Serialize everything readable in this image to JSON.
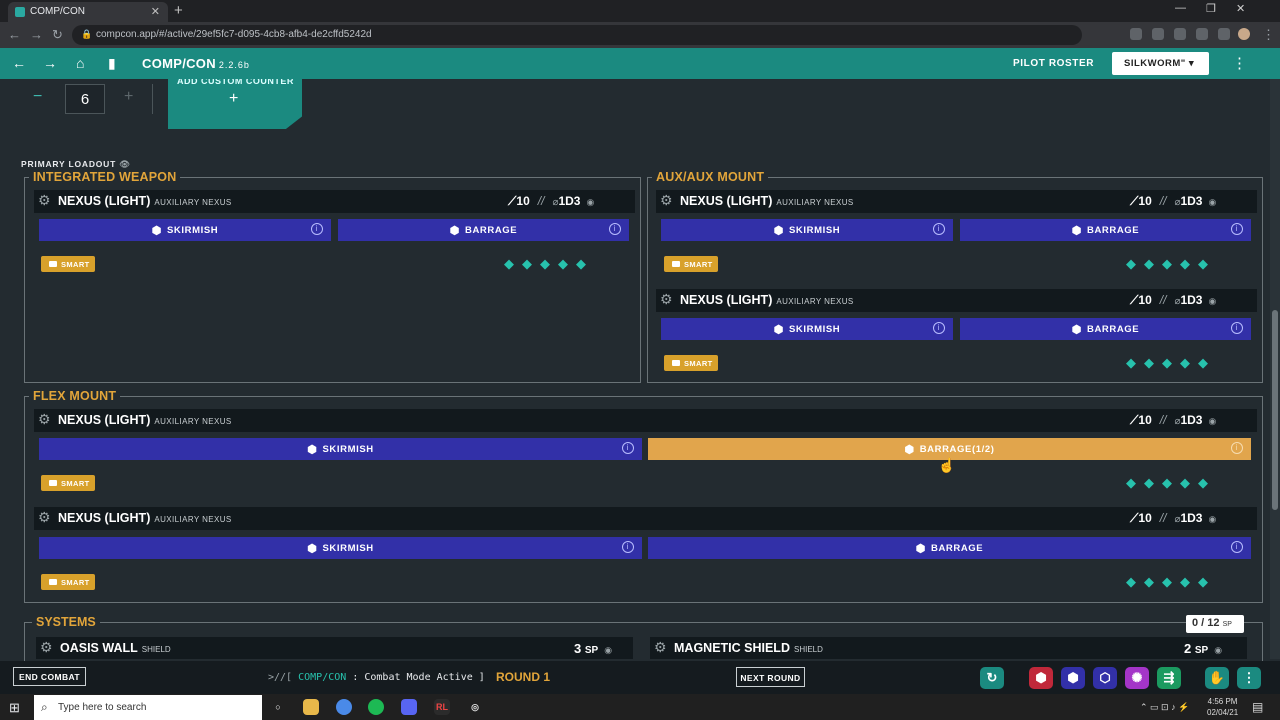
{
  "browser": {
    "tab_title": "COMP/CON",
    "url": "compcon.app/#/active/29ef5fc7-d095-4cb8-afb4-de2cffd5242d",
    "new_tab": "+",
    "close": "✕"
  },
  "header": {
    "title": "COMP/CON",
    "version": "2.2.6b",
    "pilot_roster": "PILOT ROSTER",
    "mech": "SILKWORM\"",
    "menu": "⋮"
  },
  "counter": {
    "minus": "−",
    "value": "6",
    "plus": "+",
    "add_custom": "ADD CUSTOM COUNTER",
    "add_plus": "+"
  },
  "loadout": {
    "label": "PRIMARY LOADOUT",
    "mounts": [
      {
        "title": "INTEGRATED WEAPON",
        "weapons": [
          {
            "name": "NEXUS (LIGHT)",
            "sub": "AUXILIARY NEXUS",
            "range": "10",
            "damage": "1D3",
            "modes": [
              "SKIRMISH",
              "BARRAGE"
            ],
            "tag": "SMART"
          }
        ]
      },
      {
        "title": "AUX/AUX MOUNT",
        "weapons": [
          {
            "name": "NEXUS (LIGHT)",
            "sub": "AUXILIARY NEXUS",
            "range": "10",
            "damage": "1D3",
            "modes": [
              "SKIRMISH",
              "BARRAGE"
            ],
            "tag": "SMART"
          },
          {
            "name": "NEXUS (LIGHT)",
            "sub": "AUXILIARY NEXUS",
            "range": "10",
            "damage": "1D3",
            "modes": [
              "SKIRMISH",
              "BARRAGE"
            ],
            "tag": "SMART"
          }
        ]
      },
      {
        "title": "FLEX MOUNT",
        "weapons": [
          {
            "name": "NEXUS (LIGHT)",
            "sub": "AUXILIARY NEXUS",
            "range": "10",
            "damage": "1D3",
            "modes": [
              "SKIRMISH",
              "BARRAGE(1/2)"
            ],
            "active_mode": "BARRAGE(1/2)",
            "tag": "SMART"
          },
          {
            "name": "NEXUS (LIGHT)",
            "sub": "AUXILIARY NEXUS",
            "range": "10",
            "damage": "1D3",
            "modes": [
              "SKIRMISH",
              "BARRAGE"
            ],
            "tag": "SMART"
          }
        ]
      }
    ],
    "uses_glyphs": "◆◆◆◆◆",
    "sep": "//"
  },
  "systems": {
    "title": "SYSTEMS",
    "sp_used": "0 / 12",
    "sp_unit": "SP",
    "items": [
      {
        "name": "OASIS WALL",
        "sub": "SHIELD",
        "sp": "3",
        "unit": "SP"
      },
      {
        "name": "MAGNETIC SHIELD",
        "sub": "SHIELD",
        "sp": "2",
        "unit": "SP"
      }
    ]
  },
  "footer": {
    "end_combat": "END COMBAT",
    "status_prefix": ">//[",
    "status_brand": "COMP/CON",
    "status_text": ": Combat Mode Active ]",
    "round": "ROUND 1",
    "next_round": "NEXT ROUND"
  },
  "taskbar": {
    "search": "Type here to search",
    "time": "4:56 PM",
    "date": "02/04/21"
  },
  "colors": {
    "accent": "#1b8a80",
    "mode_button": "#3230a8",
    "active_mode": "#e1a54c",
    "mount_title": "#e2a53a",
    "tag": "#d8a12b",
    "uses": "#27c2ad"
  },
  "icons": [
    "back-icon",
    "forward-icon",
    "home-icon",
    "book-icon",
    "gear-icon",
    "hexagon-icon",
    "info-icon",
    "tag-icon",
    "eye-icon",
    "range-icon",
    "damage-icon",
    "uses-diamond-icon"
  ]
}
